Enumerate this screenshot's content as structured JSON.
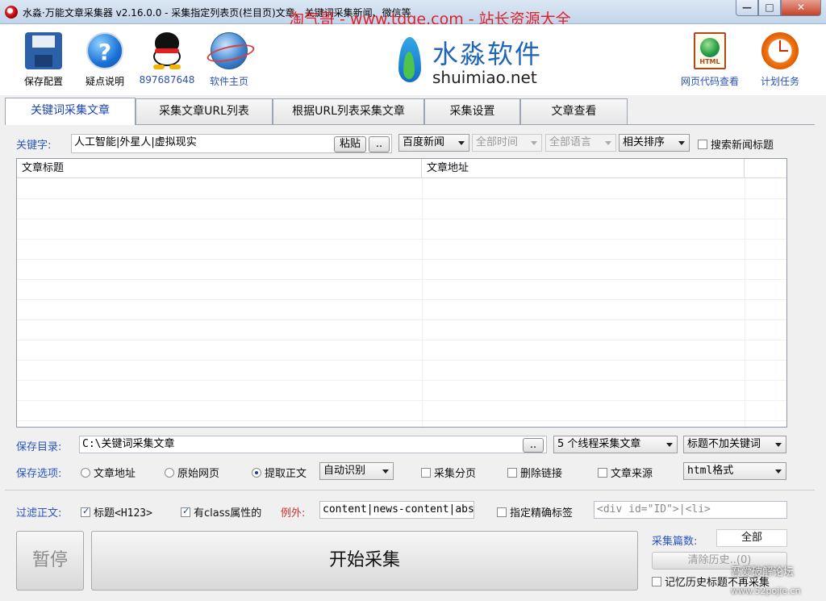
{
  "window": {
    "title": "水淼·万能文章采集器 v2.16.0.0 - 采集指定列表页(栏目页)文章、关键词采集新闻、微信等",
    "watermark": "淘气哥 - www.tqge.com - 站长资源大全",
    "min": "—",
    "max": "□",
    "close": "✕"
  },
  "toolbar": {
    "save": "保存配置",
    "help": "疑点说明",
    "help_glyph": "?",
    "qq": "897687648",
    "home": "软件主页",
    "html_view": "网页代码查看",
    "html_glyph": "HTML",
    "schedule": "计划任务"
  },
  "brand": {
    "cn": "水淼软件",
    "en": "shuimiao.net"
  },
  "tabs": [
    "关键词采集文章",
    "采集文章URL列表",
    "根据URL列表采集文章",
    "采集设置",
    "文章查看"
  ],
  "keyword": {
    "label": "关键字:",
    "value": "人工智能|外星人|虚拟现实",
    "paste": "粘贴",
    "more": "..",
    "source": "百度新闻",
    "time": "全部时间",
    "lang": "全部语言",
    "sort": "相关排序",
    "search_title": "搜索新闻标题"
  },
  "grid": {
    "col1": "文章标题",
    "col2": "文章地址"
  },
  "save_dir": {
    "label": "保存目录:",
    "value": "C:\\关键词采集文章",
    "browse": "..",
    "threads": "5 个线程采集文章",
    "title_opt": "标题不加关键词"
  },
  "save_opts": {
    "label": "保存选项:",
    "r1": "文章地址",
    "r2": "原始网页",
    "r3": "提取正文",
    "auto": "自动识别",
    "c1": "采集分页",
    "c2": "删除链接",
    "c3": "文章来源",
    "format": "html格式"
  },
  "filter": {
    "label": "过滤正文:",
    "title_tag": "标题<H123>",
    "class_attr": "有class属性的",
    "except": "例外:",
    "except_value": "content|news-content|abs",
    "precise": "指定精确标签",
    "precise_value": "<div id=\"ID\">|<li>"
  },
  "bottom": {
    "pause": "暂停",
    "start": "开始采集",
    "count_label": "采集篇数:",
    "count_value": "全部",
    "clear": "清除历史..(0)",
    "remember": "记忆历史标题不再采集",
    "wm": "吾爱破解论坛",
    "wm_url": "www.52pojie.cn"
  }
}
